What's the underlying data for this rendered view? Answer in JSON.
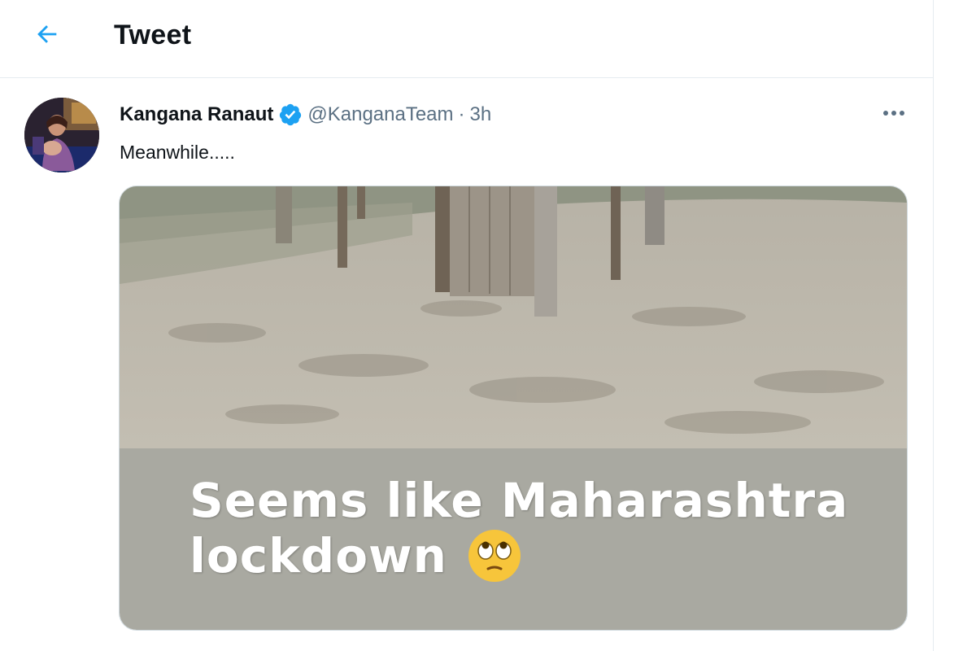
{
  "header": {
    "title": "Tweet",
    "back_icon": "arrow-left-icon",
    "accent_color": "#1da1f2"
  },
  "tweet": {
    "display_name": "Kangana Ranaut",
    "verified": true,
    "verified_icon": "verified-badge-icon",
    "handle": "@KanganaTeam",
    "separator": "·",
    "time": "3h",
    "more_icon": "more-horizontal-icon",
    "text": "Meanwhile.....",
    "media": {
      "caption_line1": "Seems like Maharashtra",
      "caption_line2": "lockdown",
      "emoji": "face-with-rolling-eyes-icon"
    }
  }
}
